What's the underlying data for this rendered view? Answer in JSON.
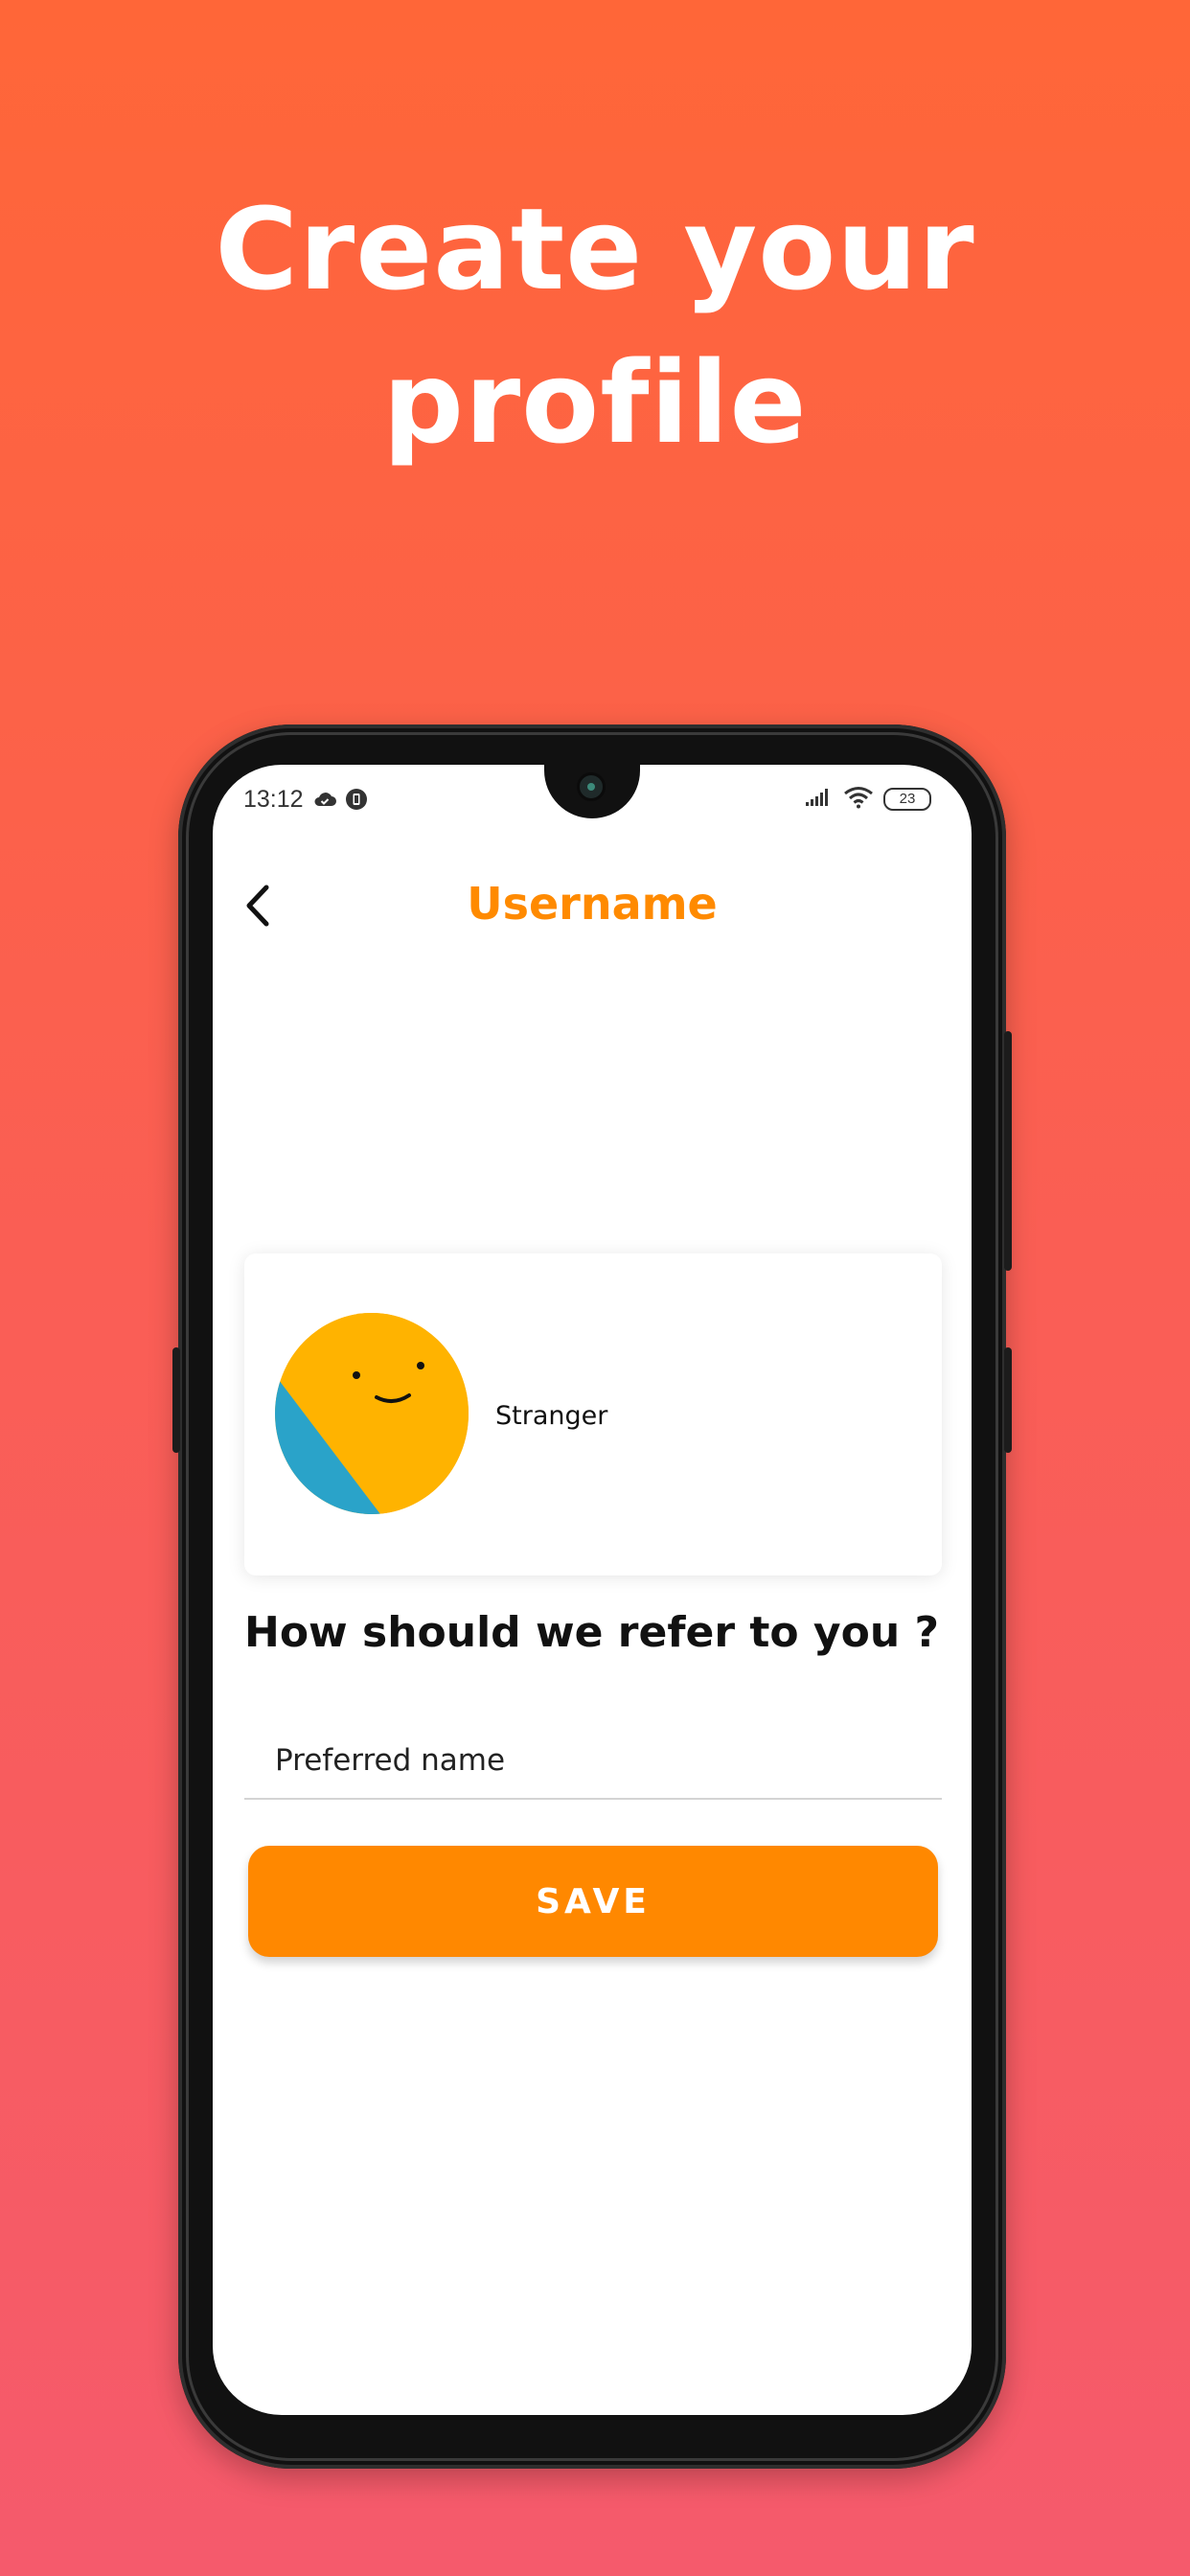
{
  "marketing": {
    "headline_line1": "Create your",
    "headline_line2": "profile",
    "text_color": "#FFFFFF"
  },
  "status_bar": {
    "time": "13:12",
    "battery": "23",
    "icons": [
      "cloud-check-icon",
      "sim-notification-icon",
      "signal-icon",
      "wifi-icon",
      "battery-icon"
    ]
  },
  "header": {
    "title": "Username",
    "back_icon": "chevron-left-icon",
    "title_color": "#FF8A00"
  },
  "profile_card": {
    "name": "Stranger",
    "avatar_icon": "smiley-avatar-icon"
  },
  "form": {
    "question": "How should we refer to you ?",
    "name_placeholder": "Preferred name",
    "name_value": ""
  },
  "actions": {
    "save_label": "SAVE",
    "save_color": "#FF8800"
  }
}
